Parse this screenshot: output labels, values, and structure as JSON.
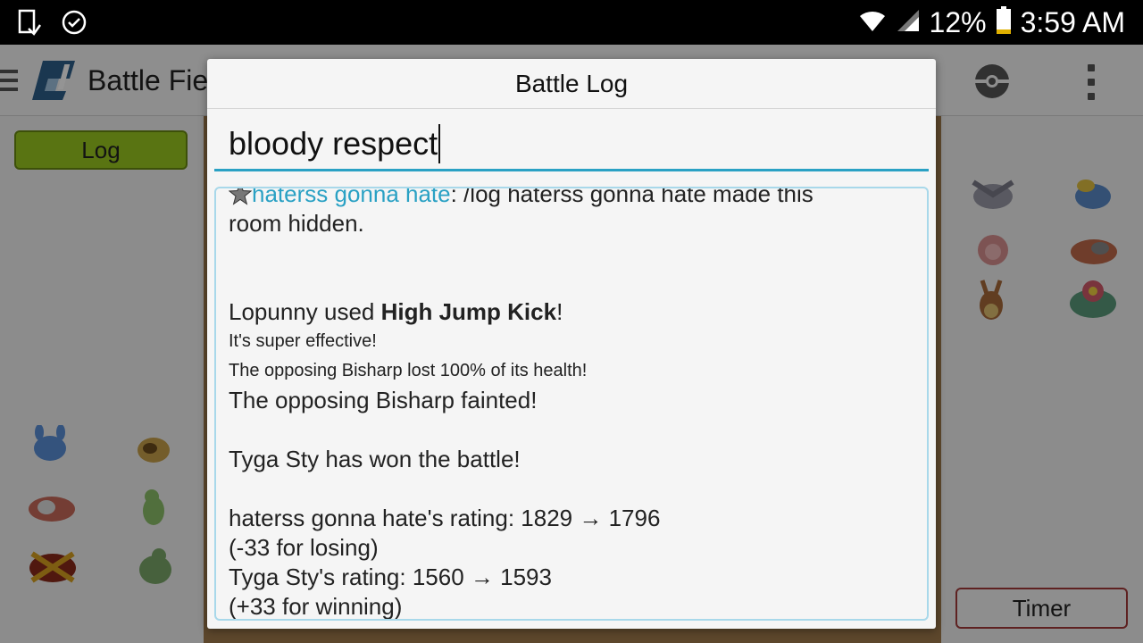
{
  "status_bar": {
    "battery_percent": "12%",
    "time": "3:59 AM"
  },
  "app": {
    "title": "Battle Fie",
    "log_button": "Log",
    "timer_button": "Timer"
  },
  "dialog": {
    "title": "Battle Log",
    "input_value": "bloody respect",
    "log": {
      "chat_user": "haterss gonna hate",
      "chat_sep": ": ",
      "chat_msg_1": "/log haterss gonna hate made this",
      "chat_msg_2": "room hidden.",
      "move_pre": "Lopunny used ",
      "move_name": "High Jump Kick",
      "move_post": "!",
      "effective": "It's super effective!",
      "health_lost": "The opposing Bisharp lost 100% of its health!",
      "fainted": "The opposing Bisharp fainted!",
      "winner": "Tyga Sty has won the battle!",
      "rating_1": "haterss gonna hate's rating: 1829 → 1796",
      "rating_1_change": "(-33 for losing)",
      "rating_2": "Tyga Sty's rating: 1560 → 1593",
      "rating_2_change": "(+33 for winning)"
    }
  },
  "colors": {
    "accent": "#2aa1c4",
    "log_button": "#9ac81f",
    "timer_border": "#a23a3a"
  }
}
